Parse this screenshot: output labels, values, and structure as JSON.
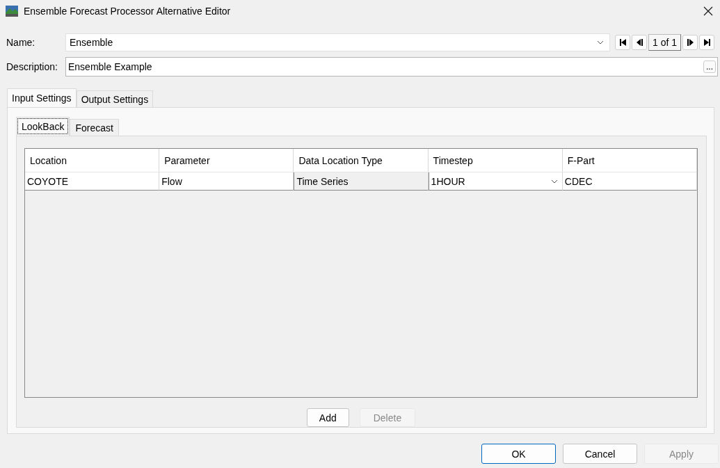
{
  "window": {
    "title": "Ensemble Forecast Processor Alternative Editor"
  },
  "name": {
    "label": "Name:",
    "value": "Ensemble"
  },
  "navigator": {
    "position": "1 of 1"
  },
  "description": {
    "label": "Description:",
    "value": "Ensemble Example",
    "more_button": "..."
  },
  "tabs": [
    {
      "label": "Input Settings",
      "selected": true
    },
    {
      "label": "Output Settings",
      "selected": false
    }
  ],
  "subtabs": [
    {
      "label": "LookBack",
      "selected": true
    },
    {
      "label": "Forecast",
      "selected": false
    }
  ],
  "table": {
    "columns": [
      "Location",
      "Parameter",
      "Data Location Type",
      "Timestep",
      "F-Part"
    ],
    "rows": [
      [
        {
          "kind": "text",
          "value": "COYOTE"
        },
        {
          "kind": "text",
          "value": "Flow"
        },
        {
          "kind": "readonly",
          "value": "Time Series"
        },
        {
          "kind": "dropdown",
          "value": "1HOUR"
        },
        {
          "kind": "text",
          "value": "CDEC"
        }
      ]
    ]
  },
  "table_buttons": [
    {
      "label": "Add",
      "disabled": false
    },
    {
      "label": "Delete",
      "disabled": true
    }
  ],
  "buttons": [
    {
      "label": "OK",
      "disabled": false,
      "default": true
    },
    {
      "label": "Cancel",
      "disabled": false,
      "default": false
    },
    {
      "label": "Apply",
      "disabled": true,
      "default": false
    }
  ]
}
